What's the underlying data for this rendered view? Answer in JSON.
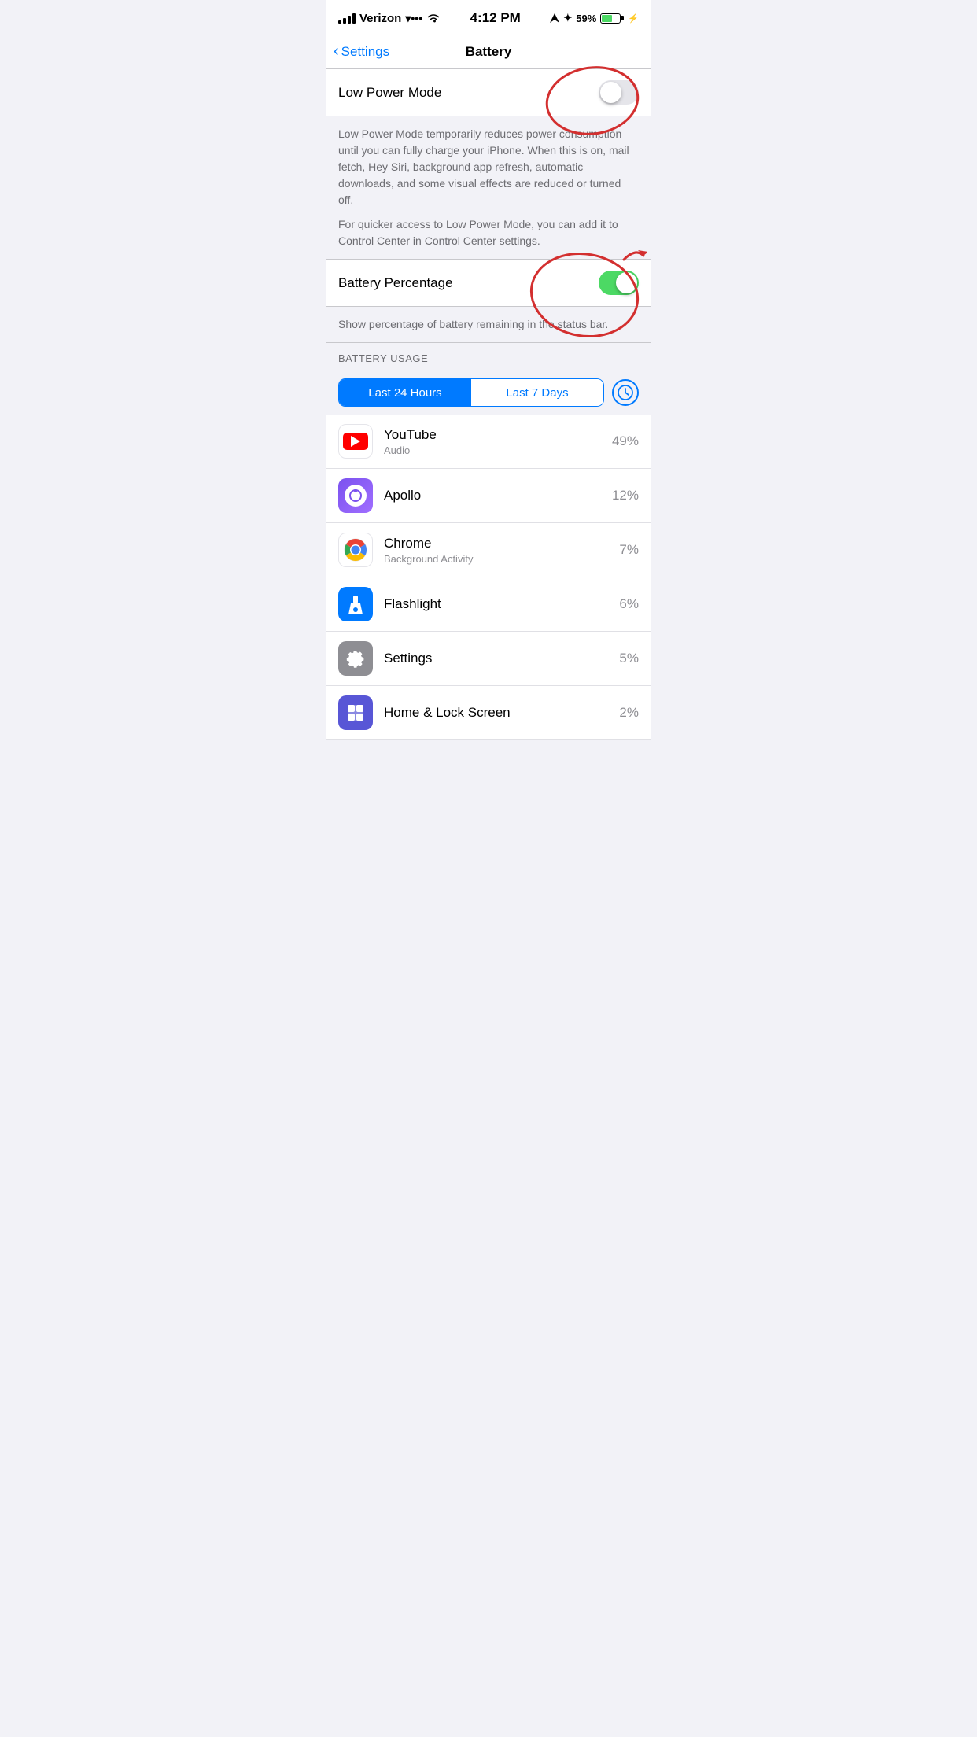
{
  "statusBar": {
    "carrier": "Verizon",
    "time": "4:12 PM",
    "battery_percent": "59%",
    "battery_level": 59
  },
  "navBar": {
    "back_label": "Settings",
    "title": "Battery"
  },
  "lowPowerMode": {
    "label": "Low Power Mode",
    "enabled": false,
    "description1": "Low Power Mode temporarily reduces power consumption until you can fully charge your iPhone. When this is on, mail fetch, Hey Siri, background app refresh, automatic downloads, and some visual effects are reduced or turned off.",
    "description2": "For quicker access to Low Power Mode, you can add it to Control Center in Control Center settings."
  },
  "batteryPercentage": {
    "label": "Battery Percentage",
    "enabled": true,
    "description": "Show percentage of battery remaining in the status bar."
  },
  "batteryUsage": {
    "sectionHeader": "BATTERY USAGE",
    "period1": "Last 24 Hours",
    "period2": "Last 7 Days",
    "apps": [
      {
        "name": "YouTube",
        "subtitle": "Audio",
        "percent": "49%",
        "icon": "youtube"
      },
      {
        "name": "Apollo",
        "subtitle": "",
        "percent": "12%",
        "icon": "apollo"
      },
      {
        "name": "Chrome",
        "subtitle": "Background Activity",
        "percent": "7%",
        "icon": "chrome"
      },
      {
        "name": "Flashlight",
        "subtitle": "",
        "percent": "6%",
        "icon": "flashlight"
      },
      {
        "name": "Settings",
        "subtitle": "",
        "percent": "5%",
        "icon": "settings"
      },
      {
        "name": "Home & Lock Screen",
        "subtitle": "",
        "percent": "2%",
        "icon": "home"
      }
    ]
  }
}
